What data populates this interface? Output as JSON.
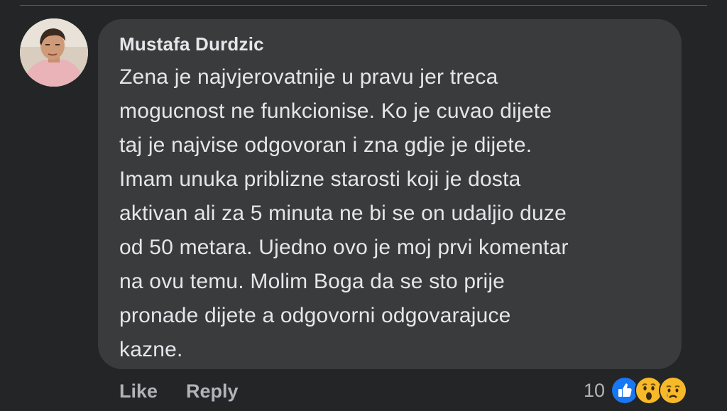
{
  "comment": {
    "author": "Mustafa Durdzic",
    "lines": [
      "Zena je najvjerovatnije u pravu jer treca",
      "mogucnost ne funkcionise. Ko je cuvao dijete",
      "taj je najvise odgovoran i zna gdje je dijete.",
      "Imam unuka priblizne starosti koji je dosta",
      "aktivan ali za 5 minuta ne bi se on udaljio duze",
      "od 50 metara. Ujedno ovo je moj prvi komentar",
      "na ovu temu. Molim Boga da se sto prije",
      "pronade dijete a odgovorni odgovarajuce",
      "kazne."
    ]
  },
  "actions": {
    "like_label": "Like",
    "reply_label": "Reply"
  },
  "reactions": {
    "count": "10",
    "icons": [
      "like-reaction-icon",
      "wow-reaction-icon",
      "sad-reaction-icon"
    ]
  },
  "colors": {
    "background": "#242526",
    "bubble": "#3a3b3c",
    "text_primary": "#e4e6eb",
    "text_secondary": "#b0b3b8",
    "like_blue": "#1877f2",
    "emoji_yellow": "#f7b928"
  }
}
